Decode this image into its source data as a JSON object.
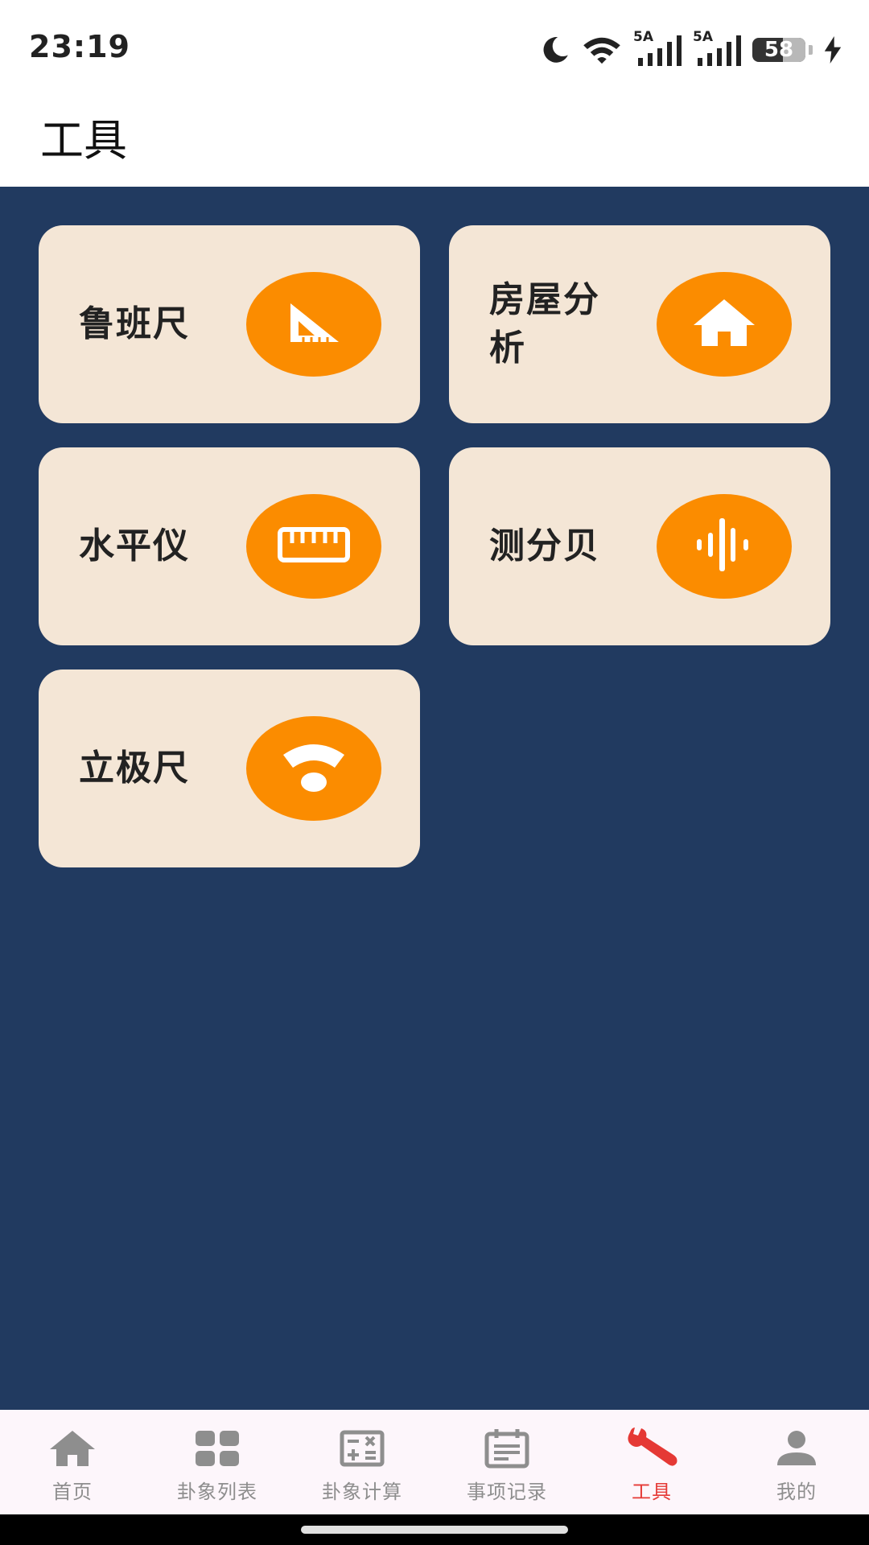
{
  "status_bar": {
    "time": "23:19",
    "battery_level": "58",
    "battery_fraction": 0.58,
    "signal_1_label": "5A",
    "signal_2_label": "5A",
    "icons": [
      "moon-icon",
      "wifi-icon",
      "signal-icon",
      "signal-icon",
      "battery-icon",
      "charging-icon"
    ]
  },
  "header": {
    "title": "工具"
  },
  "colors": {
    "content_bg": "#213a60",
    "tile_bg": "#f4e6d6",
    "accent_orange": "#fb8c00",
    "active_nav": "#e53935",
    "inactive_nav": "#8e8e8e"
  },
  "tools": [
    {
      "label": "鲁班尺",
      "icon": "set-square-icon"
    },
    {
      "label": "房屋分析",
      "icon": "house-icon"
    },
    {
      "label": "水平仪",
      "icon": "ruler-icon"
    },
    {
      "label": "测分贝",
      "icon": "sound-wave-icon"
    },
    {
      "label": "立极尺",
      "icon": "signal-fan-icon"
    }
  ],
  "bottom_nav": {
    "active_index": 4,
    "items": [
      {
        "label": "首页",
        "icon": "home-icon"
      },
      {
        "label": "卦象列表",
        "icon": "grid-icon"
      },
      {
        "label": "卦象计算",
        "icon": "calculator-icon"
      },
      {
        "label": "事项记录",
        "icon": "calendar-icon"
      },
      {
        "label": "工具",
        "icon": "wrench-icon"
      },
      {
        "label": "我的",
        "icon": "person-icon"
      }
    ]
  }
}
